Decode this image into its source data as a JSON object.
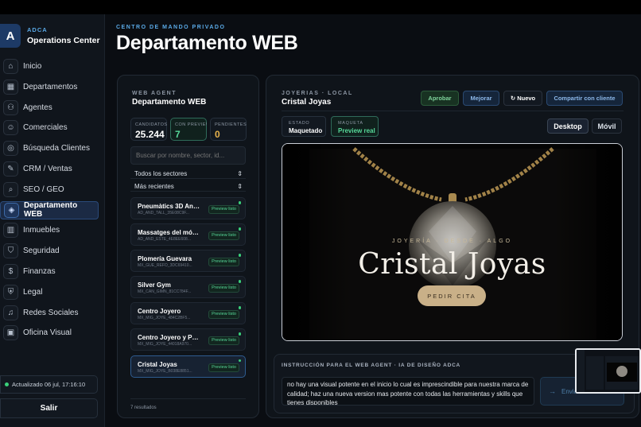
{
  "brand": {
    "logo_letter": "A",
    "kicker": "ADCA",
    "name": "Operations Center"
  },
  "nav": [
    {
      "label": "Inicio",
      "icon": "home-icon",
      "glyph": "⌂"
    },
    {
      "label": "Departamentos",
      "icon": "grid-icon",
      "glyph": "▦"
    },
    {
      "label": "Agentes",
      "icon": "agents-icon",
      "glyph": "⚇"
    },
    {
      "label": "Comerciales",
      "icon": "users-icon",
      "glyph": "☺"
    },
    {
      "label": "Búsqueda Clientes",
      "icon": "target-icon",
      "glyph": "◎"
    },
    {
      "label": "CRM / Ventas",
      "icon": "wrench-icon",
      "glyph": "✎"
    },
    {
      "label": "SEO / GEO",
      "icon": "search-icon",
      "glyph": "⌕"
    },
    {
      "label": "Departamento WEB",
      "icon": "layers-icon",
      "glyph": "◈",
      "active": true
    },
    {
      "label": "Inmuebles",
      "icon": "building-icon",
      "glyph": "▥"
    },
    {
      "label": "Seguridad",
      "icon": "shield-icon",
      "glyph": "⛉"
    },
    {
      "label": "Finanzas",
      "icon": "dollar-icon",
      "glyph": "$"
    },
    {
      "label": "Legal",
      "icon": "legal-shield-icon",
      "glyph": "⛨"
    },
    {
      "label": "Redes Sociales",
      "icon": "bell-icon",
      "glyph": "♫"
    },
    {
      "label": "Oficina Visual",
      "icon": "image-icon",
      "glyph": "▣"
    }
  ],
  "status": {
    "updated": "Actualizado 06 jul, 17:16:10"
  },
  "logout_label": "Salir",
  "header": {
    "kicker": "CENTRO DE MANDO PRIVADO",
    "title": "Departamento WEB"
  },
  "list_panel": {
    "kicker": "WEB AGENT",
    "title": "Departamento WEB",
    "stats": [
      {
        "label": "CANDIDATOS",
        "value": "25.244"
      },
      {
        "label": "CON PREVIEW",
        "value": "7"
      },
      {
        "label": "PENDIENTES",
        "value": "0"
      }
    ],
    "search_placeholder": "Buscar por nombre, sector, id...",
    "sector_select": "Todos los sectores",
    "sort_select": "Más recientes",
    "items": [
      {
        "name": "Pneumàtics 3D Andorra",
        "code": "AD_AND_TALL_35E08C9F...",
        "badge": "Preview listo"
      },
      {
        "name": "Massatges del món i...",
        "code": "AD_AND_ESTE_4E8EE608...",
        "badge": "Preview listo"
      },
      {
        "name": "Plomería Guevara",
        "code": "MX_GUE_REFO_3DC69410...",
        "badge": "Preview listo"
      },
      {
        "name": "Silver Gym",
        "code": "MX_CAN_GIMN_81CC784F...",
        "badge": "Preview listo"
      },
      {
        "name": "Centro Joyero",
        "code": "MX_MIG_JOYE_484C2BF5...",
        "badge": "Preview listo"
      },
      {
        "name": "Centro Joyero y Plata",
        "code": "MX_MIG_JOYE_44018A970...",
        "badge": "Preview listo"
      },
      {
        "name": "Cristal Joyas",
        "code": "MX_MIG_JOYE_B038E8851...",
        "badge": "Preview listo",
        "active": true
      }
    ],
    "results": "7 resultados"
  },
  "main_panel": {
    "kicker": "JOYERIAS · LOCAL",
    "title": "Cristal Joyas",
    "buttons": {
      "aprobar": "Aprobar",
      "mejorar": "Mejorar",
      "nuevo": "↻ Nuevo",
      "compartir": "Compartir con cliente"
    },
    "estado": {
      "label": "ESTADO",
      "value": "Maquetado"
    },
    "maqueta": {
      "label": "MAQUETA",
      "value": "Preview real"
    },
    "views": {
      "desktop": "Desktop",
      "movil": "Móvil"
    },
    "preview": {
      "tagline": "JOYERÍA · DESDE · ALGO",
      "title": "Cristal Joyas",
      "cta": "PEDIR CITA"
    },
    "instruction": {
      "label": "INSTRUCCIÓN PARA EL WEB AGENT · IA DE DISEÑO ADCA",
      "text": "no hay una visual potente en el inicio lo cual es imprescindible para nuestra marca de calidad; haz una nueva version mas potente con todas las herramientas y skills que tienes disponibles",
      "send": "Enviar"
    }
  },
  "colors": {
    "accent": "#5aa9e6",
    "success": "#57d99a",
    "warning": "#e7b24c",
    "gold": "#c9b088"
  }
}
